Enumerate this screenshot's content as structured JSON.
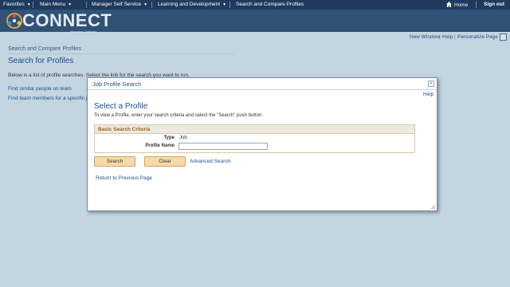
{
  "nav": {
    "favorites": "Favorites",
    "main_menu": "Main Menu",
    "manager_self_service": "Manager Self Service",
    "learning_development": "Learning and Development",
    "current": "Search and Compare Profiles",
    "home": "Home",
    "sign_out": "Sign out"
  },
  "header": {
    "logo_text": "CONNECT",
    "logo_sub": "Maryland Judiciary"
  },
  "utility": {
    "new_window": "New Window",
    "help": "Help",
    "personalize_page": "Personalize Page",
    "separator": "|"
  },
  "page": {
    "breadcrumb": "Search and Compare Profiles",
    "title": "Search for Profiles",
    "description": "Below is a list of profile searches.  Select the link for the search you want to run.",
    "link_similar": "Find similar people on team",
    "link_team": "Find team members for a specific job"
  },
  "modal": {
    "title": "Job Profile Search",
    "close": "×",
    "help": "Help",
    "heading": "Select a Profile",
    "instructions": "To view a Profile, enter your search criteria and select the \"Search\" push button.",
    "criteria_title": "Basic Search Criteria",
    "type_label": "Type",
    "type_value": "Job",
    "profile_name_label": "Profile Name",
    "profile_name_value": "",
    "search_button": "Search",
    "clear_button": "Clear",
    "advanced_search": "Advanced Search",
    "return_link": "Return to Previous Page"
  },
  "colors": {
    "nav_bg": "#1f3a5c",
    "header_bg": "#2f5276",
    "page_bg": "#c2d5e0",
    "link": "#1f4e8a",
    "button_bg": "#f9d9a6",
    "criteria_title": "#a05e16"
  },
  "icons": {
    "home": "home-icon",
    "close": "close-icon",
    "resize": "resize-grip-icon",
    "dropdown": "chevron-down-icon"
  }
}
